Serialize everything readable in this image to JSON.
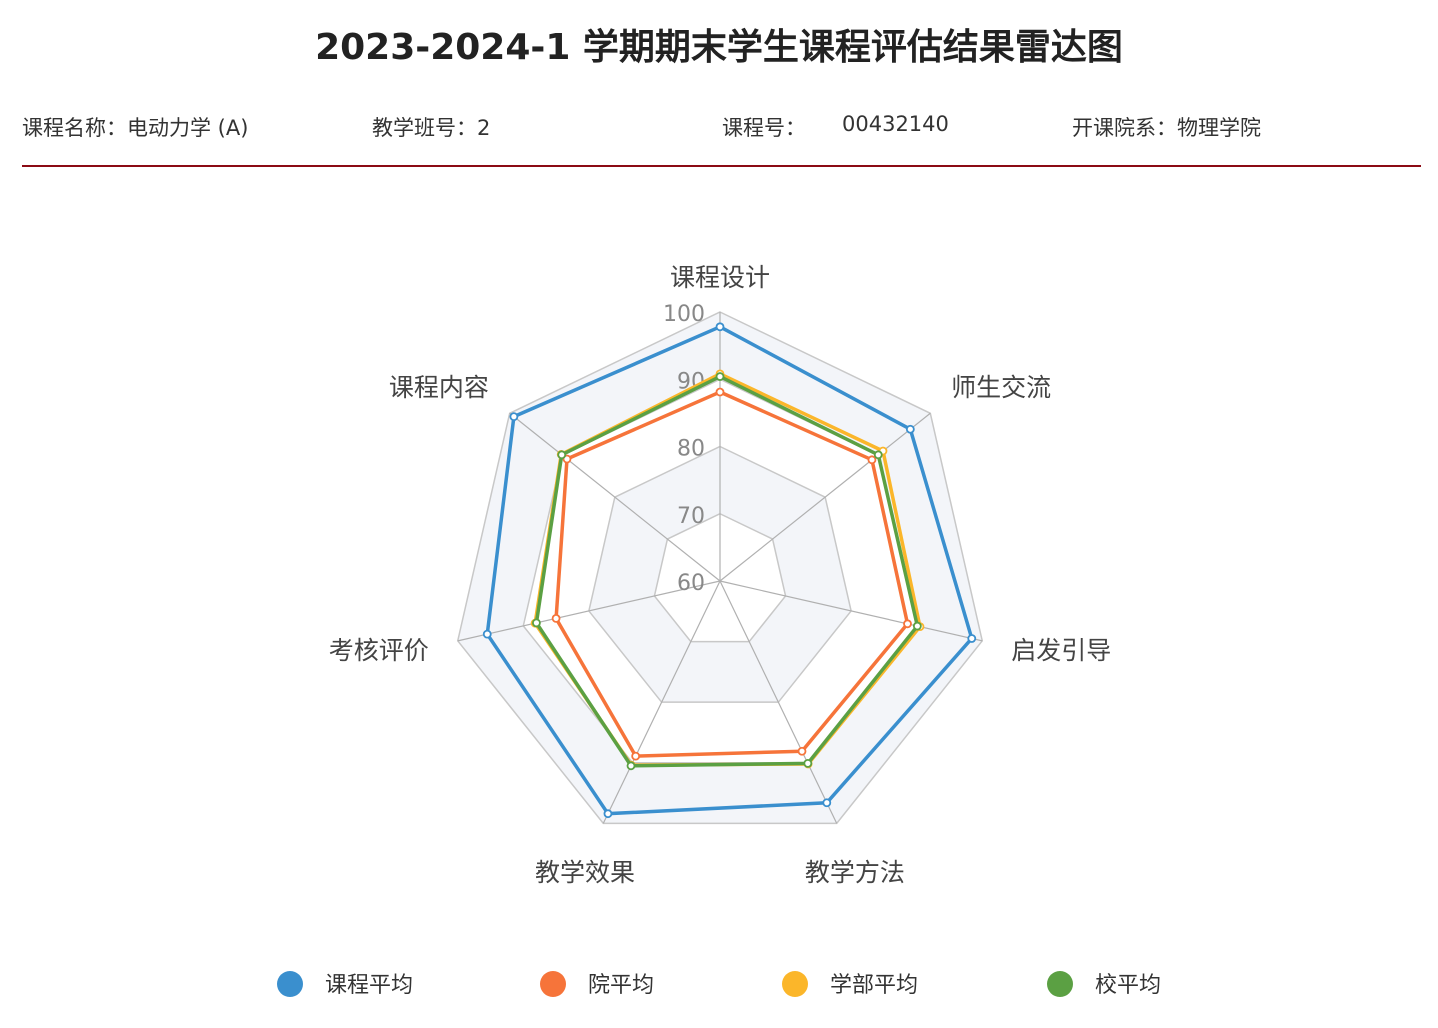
{
  "title": "2023-2024-1 学期期末学生课程评估结果雷达图",
  "info": {
    "course_name": "课程名称：电动力学 (A)",
    "class_no": "教学班号：2",
    "course_id_label": "课程号：",
    "course_id": "00432140",
    "department": "开课院系：物理学院"
  },
  "chart_data": {
    "type": "radar",
    "indicators": [
      "课程设计",
      "师生交流",
      "启发引导",
      "教学方法",
      "教学效果",
      "考核评价",
      "课程内容"
    ],
    "range": [
      60,
      100
    ],
    "ticks": [
      "60",
      "70",
      "80",
      "90",
      "100"
    ],
    "series": [
      {
        "name": "课程平均",
        "color": "#3a8fce",
        "values": [
          97.8,
          96.2,
          98.4,
          96.6,
          98.4,
          95.5,
          99.2
        ]
      },
      {
        "name": "院平均",
        "color": "#f6743a",
        "values": [
          88.1,
          88.9,
          88.6,
          88.1,
          88.9,
          85.0,
          89.1
        ]
      },
      {
        "name": "学部平均",
        "color": "#fbb62a",
        "values": [
          90.8,
          91.0,
          90.5,
          90.2,
          90.4,
          88.2,
          90.2
        ]
      },
      {
        "name": "校平均",
        "color": "#5ba043",
        "values": [
          90.4,
          90.1,
          90.1,
          90.1,
          90.5,
          88.0,
          90.1
        ]
      }
    ],
    "legend": "bottom"
  }
}
